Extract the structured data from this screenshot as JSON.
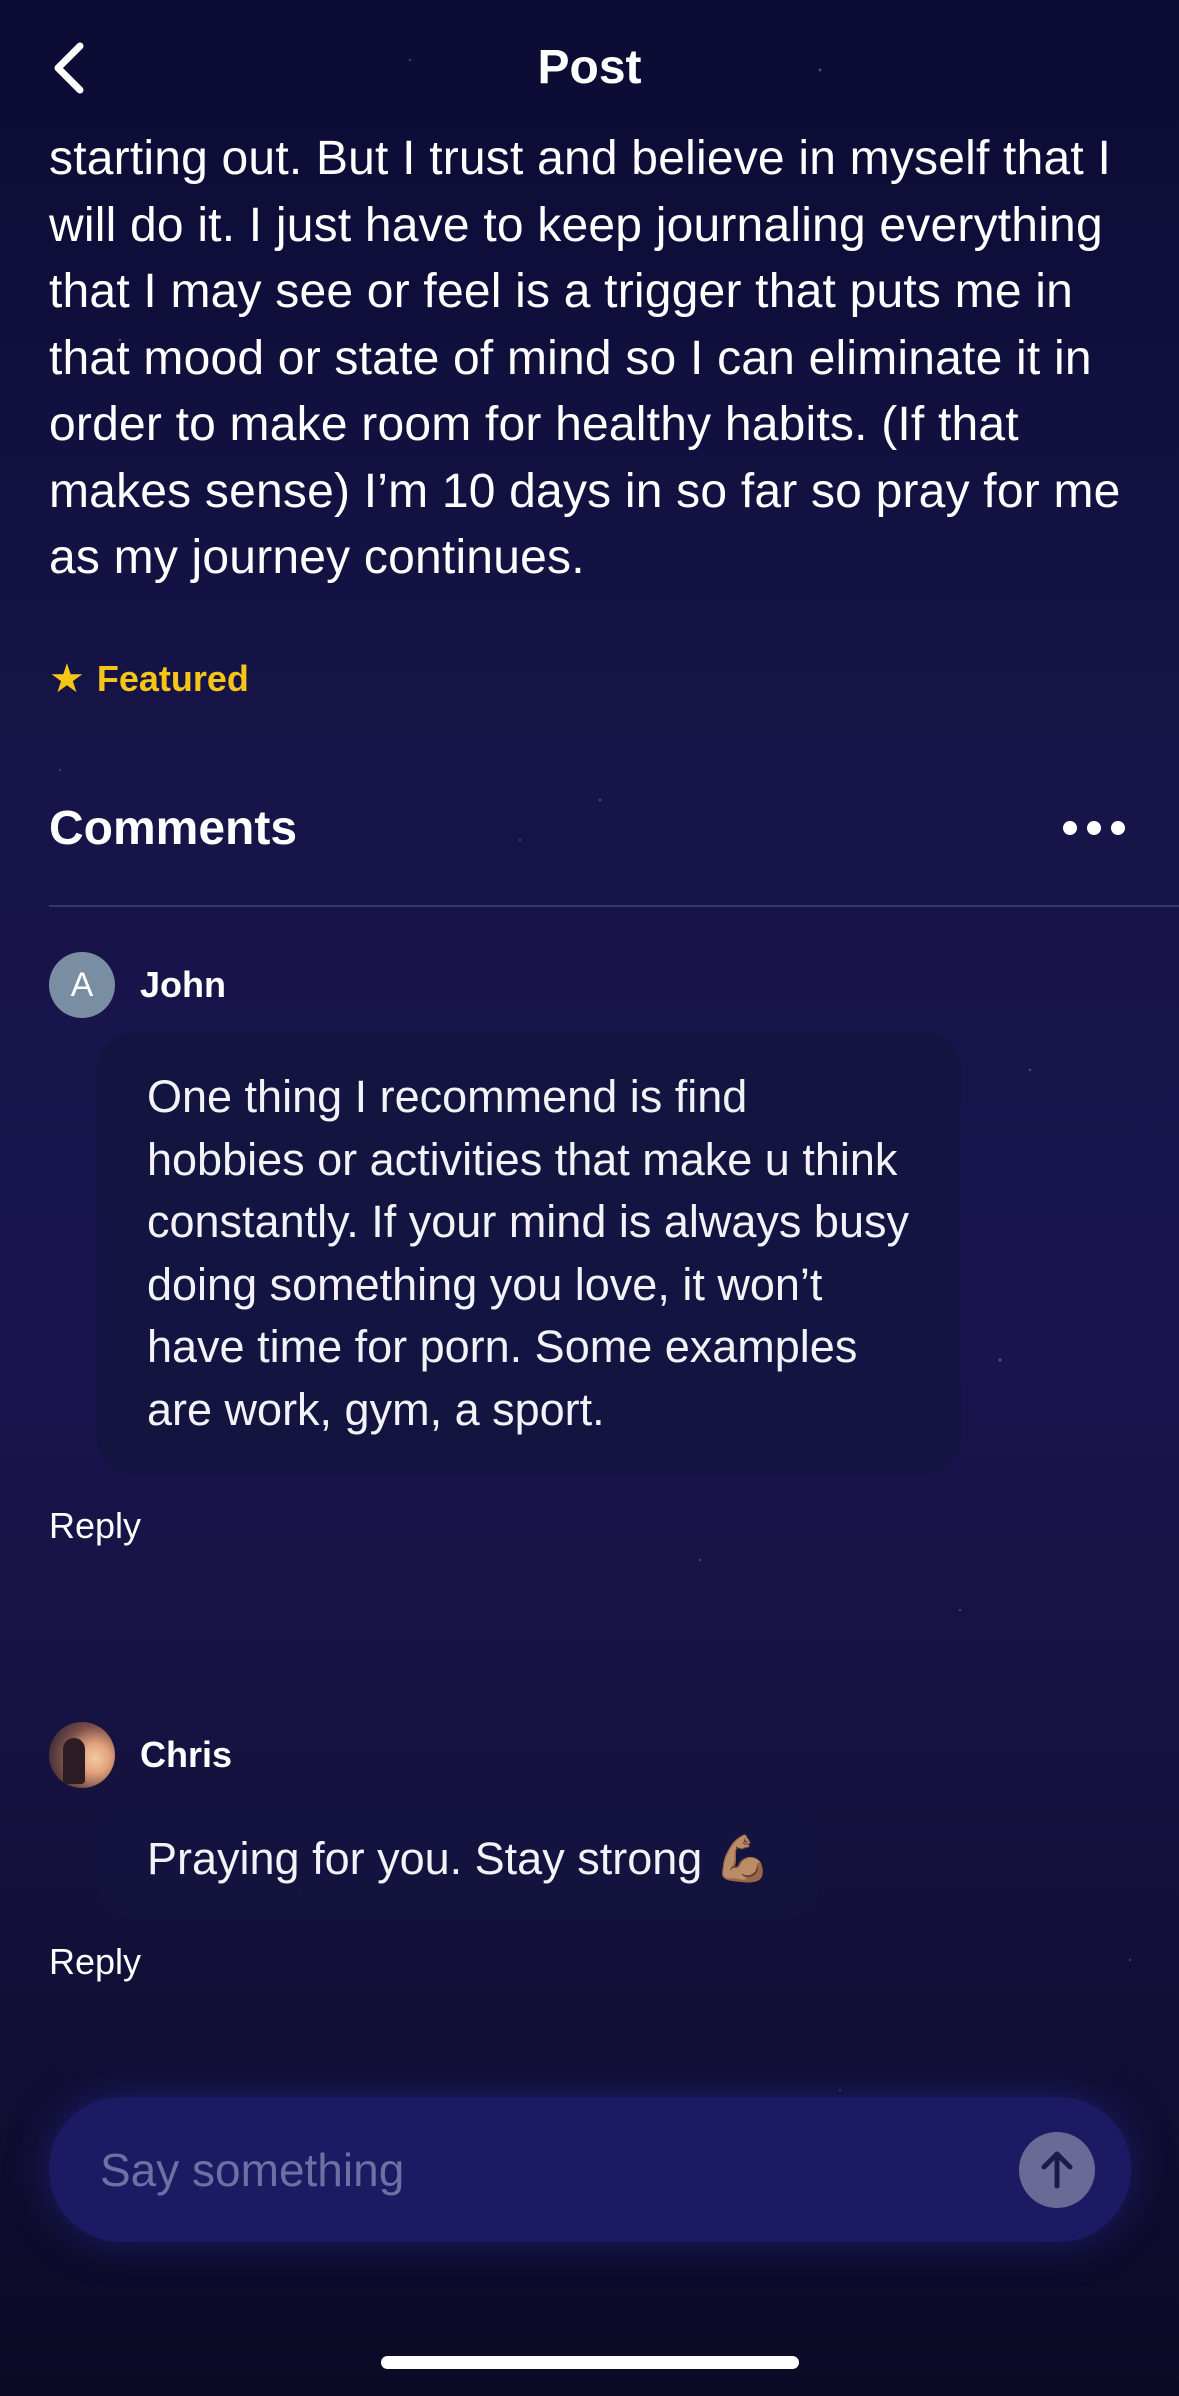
{
  "header": {
    "title": "Post",
    "back_icon": "chevron-left-icon"
  },
  "post": {
    "text": "starting out. But I trust and believe in myself that I will do it. I just have to keep journaling everything that I may see or feel is a trigger that puts me in that mood or state of mind so I can eliminate it in order to make room for healthy habits. (If that makes sense) I’m 10 days in so far so pray for me as my journey continues.",
    "featured_label": "Featured",
    "featured_icon": "star-icon"
  },
  "comments": {
    "title": "Comments",
    "more_icon": "more-horizontal-icon",
    "items": [
      {
        "avatar_letter": "A",
        "author": "John",
        "text": "One thing I recommend is find hobbies or activities that make u think constantly. If your mind is always busy doing something you love, it won’t have time for porn. Some examples are work, gym, a sport.",
        "reply_label": "Reply"
      },
      {
        "author": "Chris",
        "text": "Praying for you. Stay strong 💪🏽",
        "reply_label": "Reply"
      }
    ]
  },
  "composer": {
    "placeholder": "Say something",
    "send_icon": "arrow-up-icon"
  },
  "colors": {
    "featured": "#f5c518",
    "bubble": "#141440",
    "composer": "#1b1a63"
  }
}
